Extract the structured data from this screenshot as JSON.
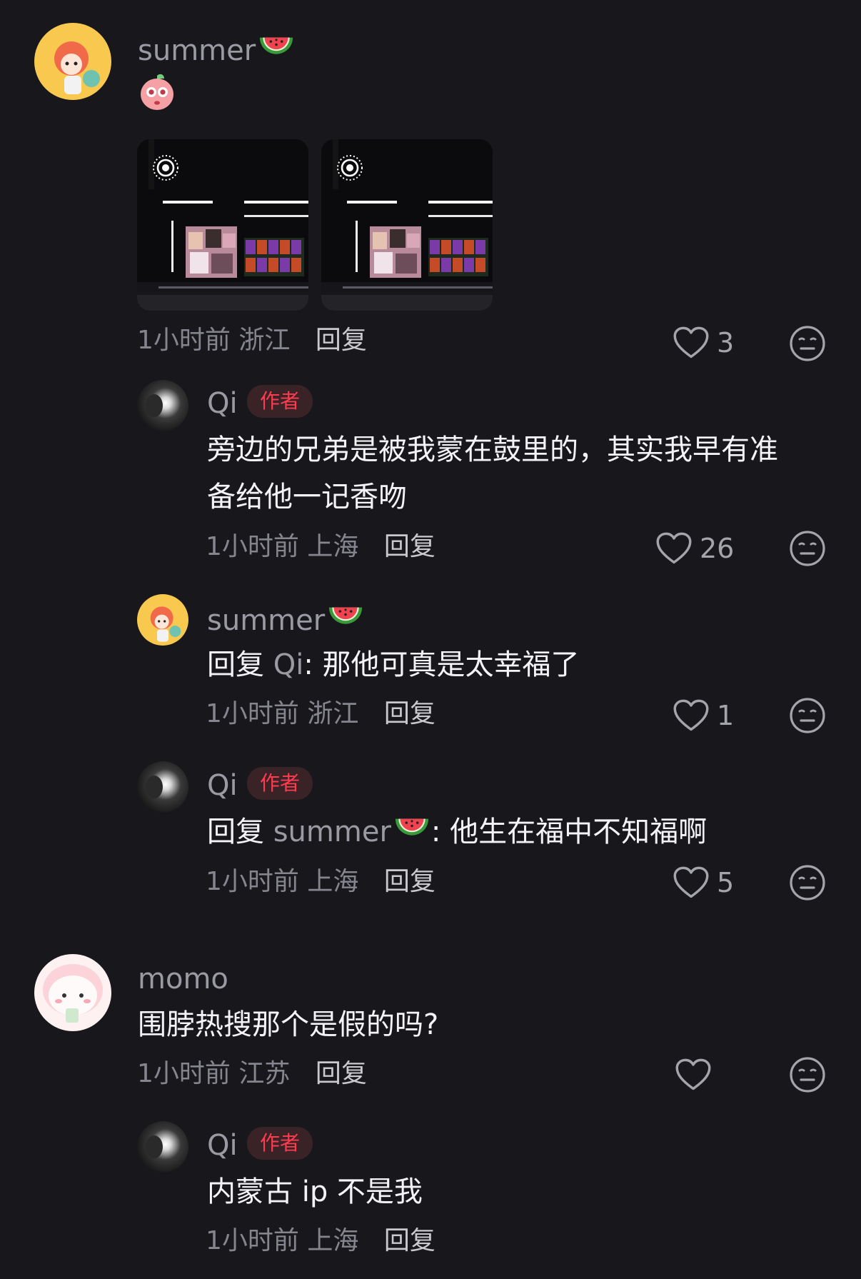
{
  "comments": [
    {
      "username": "summer",
      "sticker": "peach-sticker",
      "photos": [
        "concert-photo-1",
        "concert-photo-2"
      ],
      "time": "1小时前",
      "location": "浙江",
      "reply_label": "回复",
      "likes": "3",
      "replies": [
        {
          "username": "Qi",
          "badge": "作者",
          "text_line1": "旁边的兄弟是被我蒙在鼓里的，其实我早有准",
          "text_line2": "备给他一记香吻",
          "time": "1小时前",
          "location": "上海",
          "reply_label": "回复",
          "likes": "26"
        },
        {
          "username": "summer",
          "reply_prefix": "回复",
          "mention": "Qi",
          "text": ": 那他可真是太幸福了",
          "time": "1小时前",
          "location": "浙江",
          "reply_label": "回复",
          "likes": "1"
        },
        {
          "username": "Qi",
          "badge": "作者",
          "reply_prefix": "回复",
          "mention": "summer",
          "text": ": 他生在福中不知福啊",
          "time": "1小时前",
          "location": "上海",
          "reply_label": "回复",
          "likes": "5"
        }
      ]
    },
    {
      "username": "momo",
      "text": "围脖热搜那个是假的吗?",
      "time": "1小时前",
      "location": "江苏",
      "reply_label": "回复",
      "likes": "",
      "replies": [
        {
          "username": "Qi",
          "badge": "作者",
          "text": "内蒙古 ip 不是我",
          "time": "1小时前",
          "location": "上海",
          "reply_label": "回复"
        }
      ]
    }
  ],
  "icons": {
    "like": "heart-outline-icon",
    "dislike": "meh-face-icon",
    "emoji": "watermelon-icon",
    "live_photo": "live-photo-icon"
  },
  "colors": {
    "background": "#17171c",
    "author_badge_text": "#ff3b4f",
    "author_badge_bg": "#3a2326"
  }
}
